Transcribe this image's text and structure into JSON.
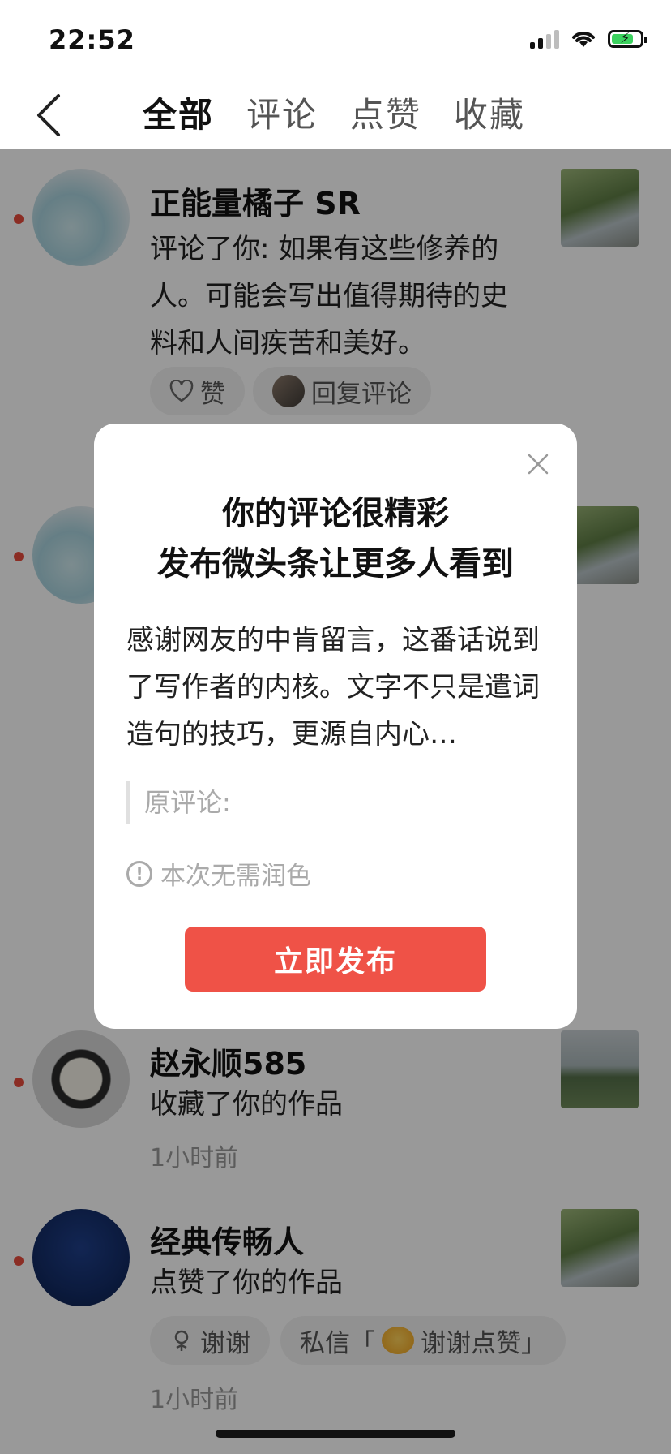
{
  "status_bar": {
    "time": "22:52"
  },
  "header": {
    "tabs": [
      "全部",
      "评论",
      "点赞",
      "收藏"
    ],
    "active_tab": 0
  },
  "notifications": [
    {
      "name": "正能量橘子 SR",
      "text": "评论了你: 如果有这些修养的人。可能会写出值得期待的史料和人间疾苦和美好。",
      "actions": [
        "赞",
        "回复评论"
      ]
    },
    {
      "name": "赵永顺585",
      "text": "收藏了你的作品",
      "time": "1小时前"
    },
    {
      "name": "经典传畅人",
      "text": "点赞了你的作品",
      "actions": [
        "谢谢",
        "私信「",
        "谢谢点赞」"
      ],
      "time": "1小时前"
    }
  ],
  "modal": {
    "title_line1": "你的评论很精彩",
    "title_line2": "发布微头条让更多人看到",
    "body": "感谢网友的中肯留言，这番话说到了写作者的内核。文字不只是遣词造句的技巧，更源自内心…",
    "original_label": "原评论:",
    "hint": "本次无需润色",
    "publish_label": "立即发布"
  },
  "colors": {
    "accent": "#ef5247",
    "unread_dot": "#e84b3c"
  }
}
